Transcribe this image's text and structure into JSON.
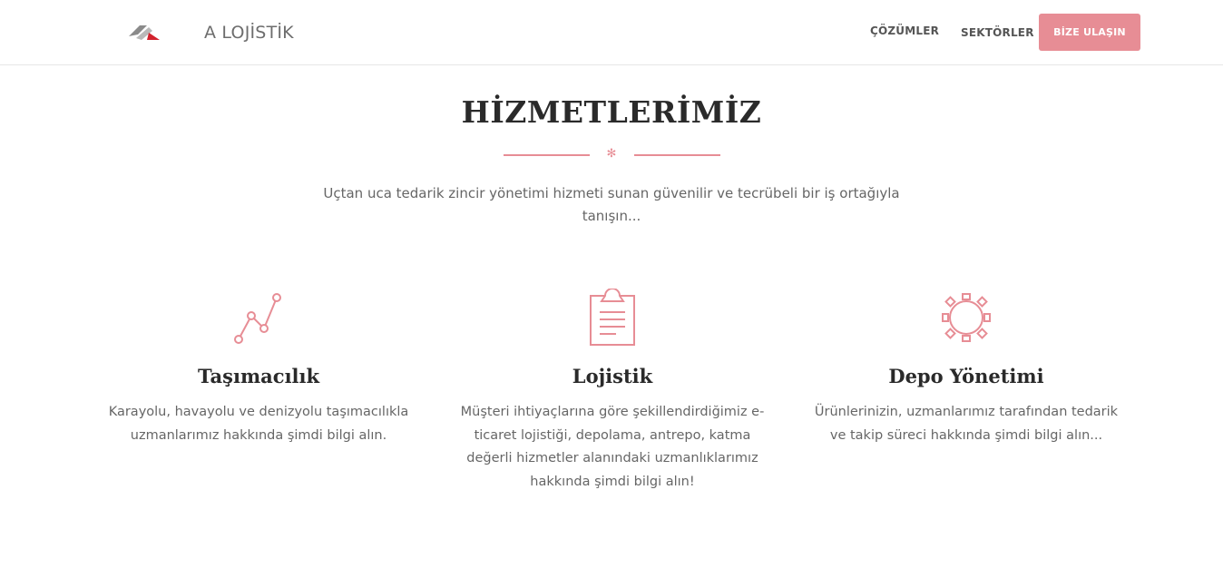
{
  "header": {
    "brand": "A LOJİSTİK",
    "nav": [
      {
        "label": "ÇÖZÜMLER"
      },
      {
        "label": "SEKTÖRLER"
      }
    ],
    "cta_label": "BİZE ULAŞIN",
    "logo_icon": "logo-arrow-icon"
  },
  "section": {
    "title": "HİZMETLERİMİZ",
    "divider_icon": "snowflake-star-icon",
    "subtitle": "Uçtan uca tedarik zincir yönetimi hizmeti sunan güvenilir ve tecrübeli bir iş ortağıyla tanışın..."
  },
  "services": [
    {
      "icon": "line-chart-icon",
      "title": "Taşımacılık",
      "text": "Karayolu, havayolu ve denizyolu taşımacılıkla uzmanlarımız hakkında şimdi bilgi alın."
    },
    {
      "icon": "clipboard-icon",
      "title": "Lojistik",
      "text": "Müşteri ihtiyaçlarına göre şekillendirdiğimiz e-ticaret lojistiği, depolama, antrepo, katma değerli hizmetler alanındaki uzmanlıklarımız hakkında şimdi bilgi alın!"
    },
    {
      "icon": "gear-icon",
      "title": "Depo Yönetimi",
      "text": "Ürünlerinizin, uzmanlarımız tarafından tedarik ve takip süreci hakkında şimdi bilgi alın..."
    }
  ],
  "colors": {
    "accent": "#e78d95",
    "text": "#666666",
    "heading": "#2a2a2a"
  }
}
